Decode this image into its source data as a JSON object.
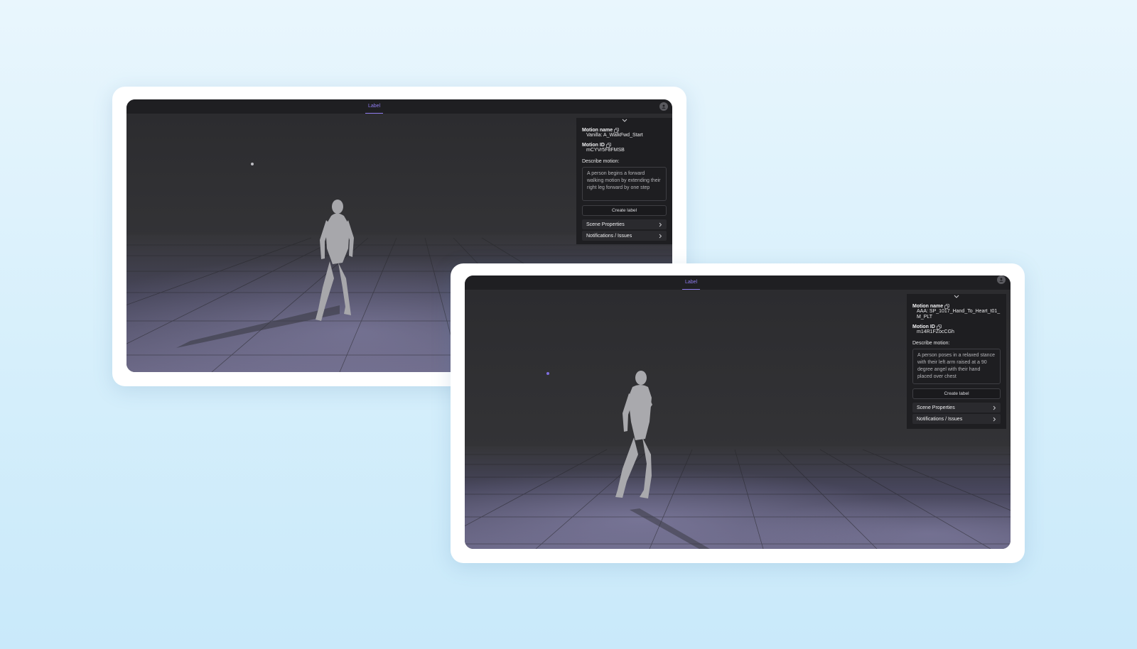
{
  "windows": [
    {
      "tab_label": "Label",
      "motion_name_label": "Motion name",
      "motion_name_value": "Vanilla: A_WalkFwd_Start",
      "motion_id_label": "Motion ID",
      "motion_id_value": "mCYVr5F8FMSB",
      "describe_label": "Describe motion:",
      "description": "A person begins a forward walking motion by extending their right leg forward by one step",
      "create_label_button": "Create label",
      "scene_properties": "Scene Properties",
      "notifications": "Notifications / Issues",
      "icons": {
        "collapse": "chevron-down-icon",
        "copy": "copy-icon",
        "expand": "chevron-right-icon",
        "avatar": "user-icon"
      }
    },
    {
      "tab_label": "Label",
      "motion_name_label": "Motion name",
      "motion_name_value": "AAA: SP_1017_Hand_To_Heart_t01_M_PLT",
      "motion_id_label": "Motion ID",
      "motion_id_value": "m14R1FZocCGh",
      "describe_label": "Describe motion:",
      "description": "A person poses in a relaxed stance with their left arm raised at a 90 degree angel with their hand placed over chest",
      "create_label_button": "Create label",
      "scene_properties": "Scene Properties",
      "notifications": "Notifications / Issues",
      "icons": {
        "collapse": "chevron-down-icon",
        "copy": "copy-icon",
        "expand": "chevron-right-icon",
        "avatar": "user-icon"
      }
    }
  ],
  "colors": {
    "accent": "#8f7cf0",
    "panel_bg": "#1e1e21",
    "viewport_bg": "#2e2e31",
    "floor_light": "#7d7a9a",
    "figure": "#a9a9ad"
  }
}
